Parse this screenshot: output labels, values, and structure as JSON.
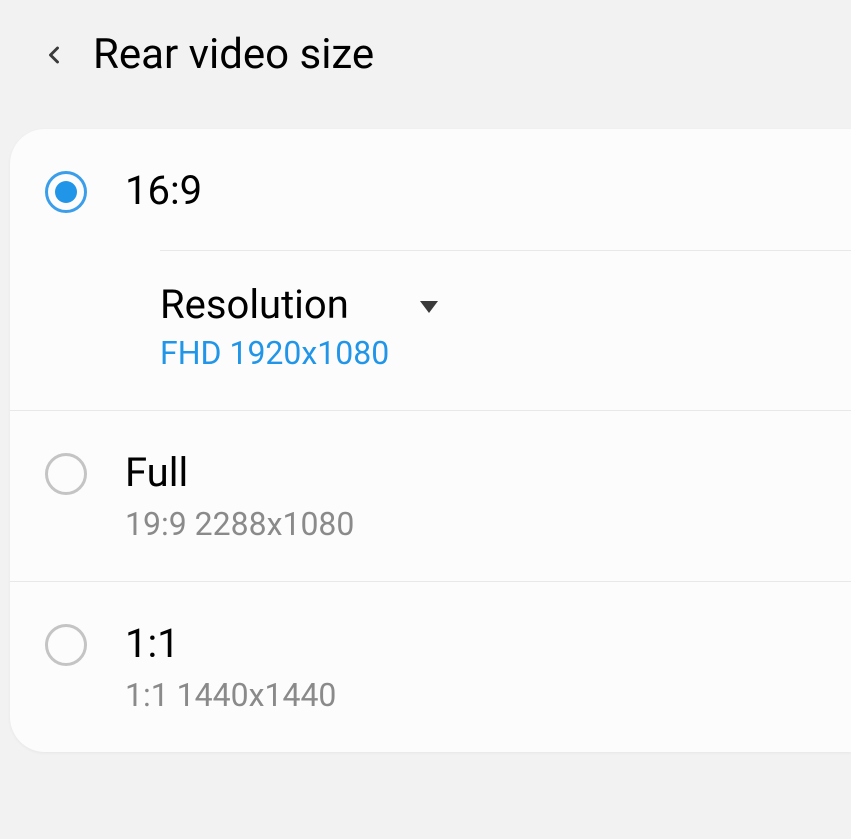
{
  "header": {
    "title": "Rear video size"
  },
  "options": [
    {
      "title": "16:9",
      "selected": true,
      "resolution": {
        "label": "Resolution",
        "value": "FHD 1920x1080"
      }
    },
    {
      "title": "Full",
      "subtitle": "19:9 2288x1080",
      "selected": false
    },
    {
      "title": "1:1",
      "subtitle": "1:1 1440x1440",
      "selected": false
    }
  ]
}
